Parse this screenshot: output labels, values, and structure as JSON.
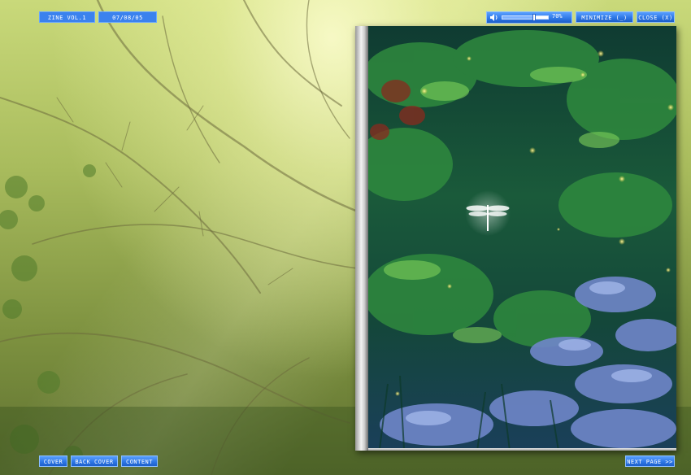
{
  "header": {
    "title_label": "ZINE VOL.1",
    "date_label": "07/08/05",
    "minimize_label": "MINIMIZE (_)",
    "close_label": "CLOSE (X)"
  },
  "volume": {
    "level": 0.7,
    "label": "70%",
    "icon": "speaker-icon"
  },
  "footer": {
    "cover_label": "COVER",
    "back_cover_label": "BACK COVER",
    "content_label": "CONTENT",
    "next_page_label": "NEXT PAGE >>"
  },
  "colors": {
    "button_blue": "#2f78e6",
    "button_border": "#8ec0ff",
    "page_green": "#1f6a3c",
    "rock_blue": "#6f86c9"
  }
}
